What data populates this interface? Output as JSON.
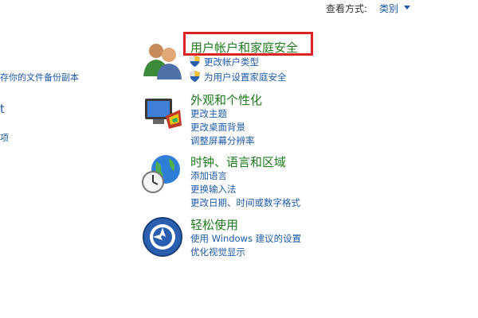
{
  "view_by": {
    "label": "查看方式:",
    "value": "类别"
  },
  "left_links": [
    {
      "text": "存你的文件备份副本"
    },
    {
      "text": "t"
    },
    {
      "text": "项"
    }
  ],
  "groups": [
    {
      "heading": "用户帐户和家庭安全",
      "icon": "users-icon",
      "links": [
        {
          "text": "更改帐户类型",
          "icon": "uac-shield-icon"
        },
        {
          "text": "为用户设置家庭安全",
          "icon": "uac-shield-icon"
        }
      ]
    },
    {
      "heading": "外观和个性化",
      "icon": "monitor-palette-icon",
      "links": [
        {
          "text": "更改主题"
        },
        {
          "text": "更改桌面背景"
        },
        {
          "text": "调整屏幕分辨率"
        }
      ]
    },
    {
      "heading": "时钟、语言和区域",
      "icon": "globe-clock-icon",
      "links": [
        {
          "text": "添加语言"
        },
        {
          "text": "更换输入法"
        },
        {
          "text": "更改日期、时间或数字格式"
        }
      ]
    },
    {
      "heading": "轻松使用",
      "icon": "ease-of-access-icon",
      "links": [
        {
          "text": "使用 Windows 建议的设置"
        },
        {
          "text": "优化视觉显示"
        }
      ]
    }
  ],
  "colors": {
    "link": "#1e5aa8",
    "heading": "#1e7a1e",
    "highlight": "#dd2222"
  }
}
